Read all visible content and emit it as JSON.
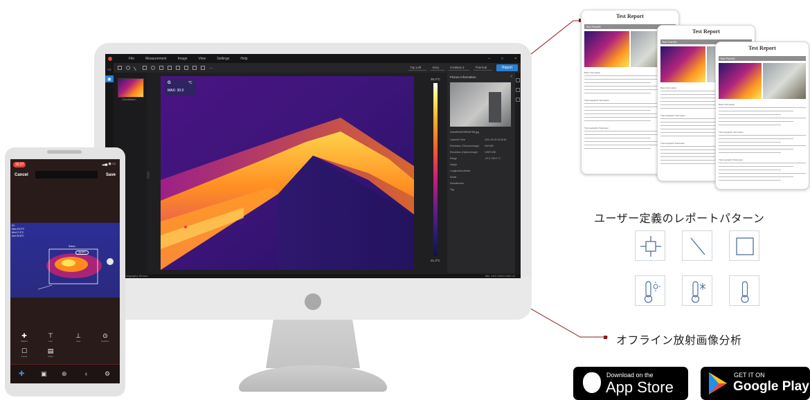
{
  "app": {
    "menu": [
      "File",
      "Measurement",
      "Image",
      "View",
      "Settings",
      "Help"
    ],
    "window_controls": [
      "–",
      "□",
      "×"
    ],
    "toolbar_selects": [
      "Top Left",
      "Grey",
      "IronBow 2",
      "Thermal"
    ],
    "report_button": "Report",
    "thumbnail_label": "Corvellou4…",
    "overlay": {
      "unit": "°C",
      "max": "MAX: 30.0"
    },
    "scale": {
      "top": "30.2°C",
      "bottom": "21.3°C"
    },
    "info_panel": {
      "title": "Picture information",
      "filename": "IrSeeRx00978FA4FS8.jpg",
      "rows": [
        [
          "Captured Time",
          "2021-03-09 16:30:54"
        ],
        [
          "Resolution (Thermal image)",
          "640*480"
        ],
        [
          "Resolution (Optical image)",
          "1280*1280"
        ],
        [
          "Range",
          "-20.0~150.0 °C"
        ],
        [
          "Height",
          ""
        ],
        [
          "Longitude&Latitude",
          ""
        ],
        [
          "Model",
          ""
        ],
        [
          "Manufacturer",
          ""
        ],
        [
          "Tag",
          ""
        ]
      ]
    },
    "status_left": "Out Thermography Sensor",
    "status_right": "Min: 18.5  1920×1080  x2"
  },
  "phone": {
    "time": "16:27",
    "cancel": "Cancel",
    "save": "Save",
    "readouts": [
      "S1",
      "Max:23.9°C",
      "Min:17.5°C",
      "Ave:20.8°C"
    ],
    "box_label": "Sobox",
    "temp_tag": "26.8°C",
    "tools_row1": [
      "Marker",
      "Line",
      "Area",
      "Isotherm"
    ],
    "tools_row2": [
      "Frame",
      "Other"
    ]
  },
  "reports": {
    "title": "Test Report",
    "bar": "Test Point01",
    "basic": "Basic Information",
    "thermo": "Thermographic Information",
    "params": "Thermographic Parameter"
  },
  "labels": {
    "report_pattern": "ユーザー定義のレポートパターン",
    "offline": "オフライン放射画像分析"
  },
  "stores": {
    "apple_small": "Download on the",
    "apple_big": "App Store",
    "google_small": "GET IT ON",
    "google_big": "Google Play"
  },
  "colors": {
    "accent": "#2a7fd4",
    "connector": "#8b1a1a"
  }
}
